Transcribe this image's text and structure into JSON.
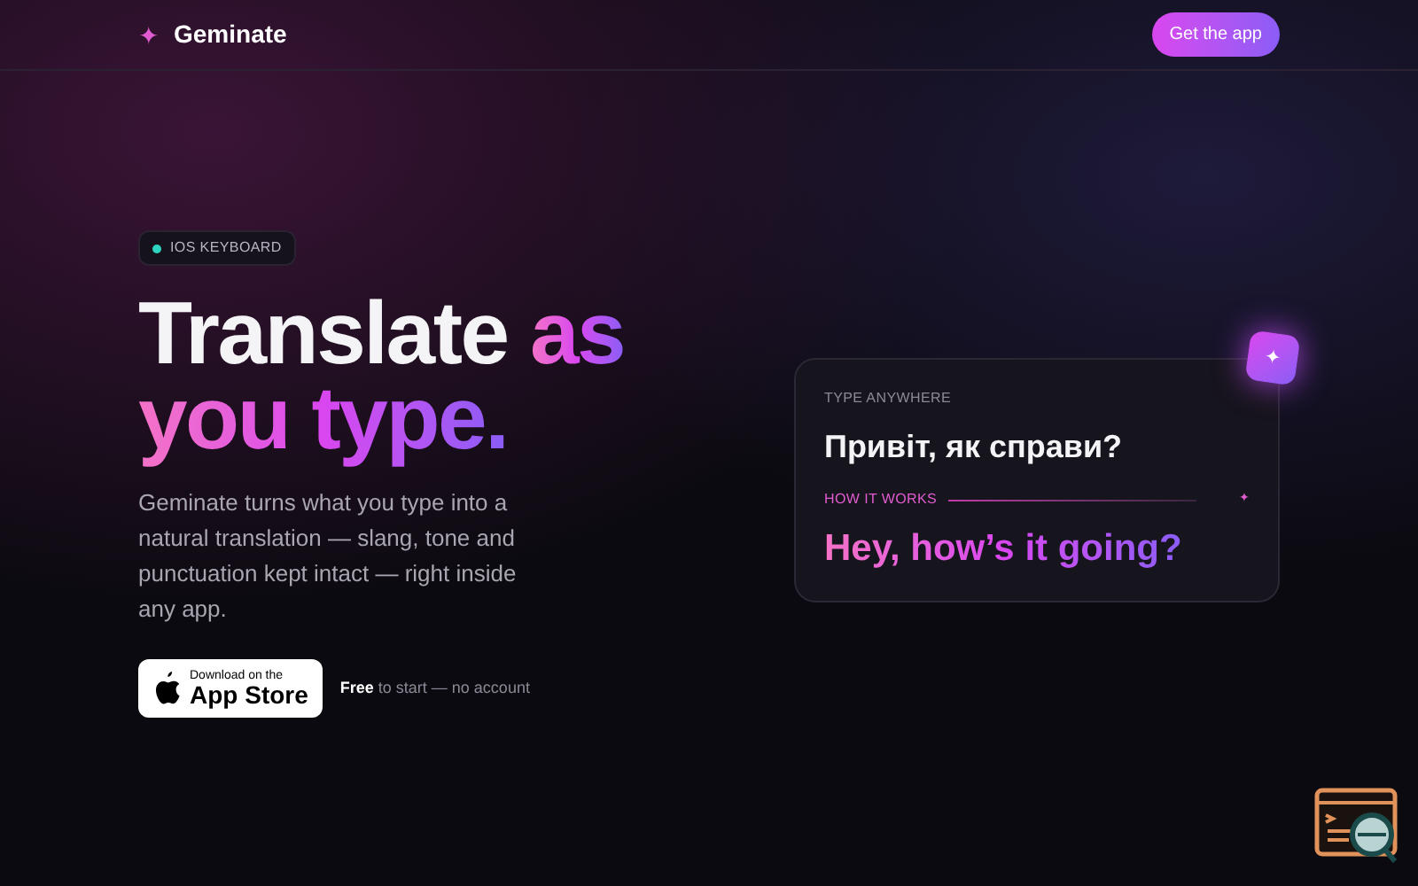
{
  "nav": {
    "brand": "Geminate",
    "brand_mark": "✦",
    "cta": "Get the app"
  },
  "hero": {
    "badge": "IOS KEYBOARD",
    "headline_plain": "Translate",
    "headline_accent_line1": "as",
    "headline_accent_line2": "you type.",
    "description": "Geminate turns what you type into a natural translation — slang, tone and punctuation kept intact — right inside any app.",
    "store_small": "Download on the",
    "store_big": "App Store",
    "note": "**Free** to start — no account"
  },
  "card": {
    "sparkle": "✦",
    "label": "TYPE ANYWHERE",
    "source": "Привіт, як справи?",
    "divider_label": "HOW IT WORKS",
    "divider_mark": "✦",
    "translation": "Hey, how’s it going?"
  }
}
